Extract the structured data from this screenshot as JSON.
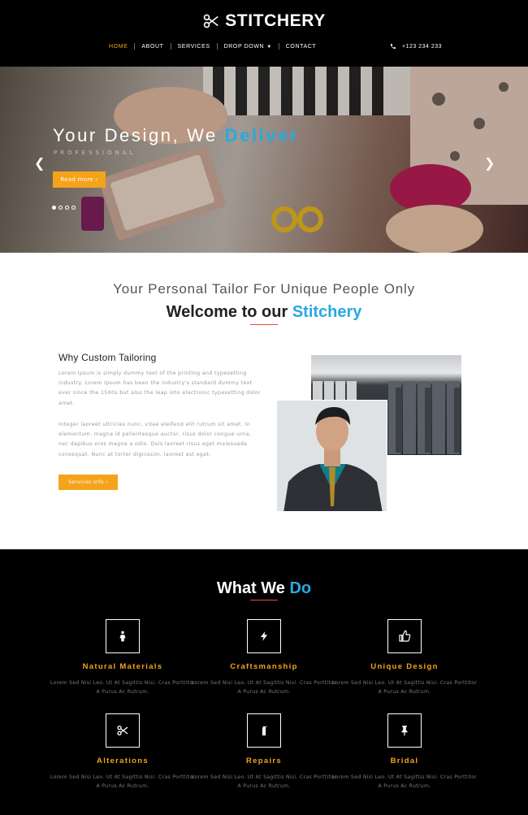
{
  "brand": {
    "name": "STITCHERY"
  },
  "nav": {
    "items": [
      "HOME",
      "ABOUT",
      "SERVICES",
      "DROP DOWN",
      "CONTACT"
    ],
    "active": "HOME",
    "phone": "+123 234 233"
  },
  "hero": {
    "title_part1": "Your Design, We",
    "title_accent": "Deliver",
    "subtitle": "Professional",
    "button": "Read more ›",
    "slides": 4,
    "active_slide": 1
  },
  "about": {
    "tagline": "Your Personal Tailor For Unique People Only",
    "title_part1": "Welcome to our",
    "title_accent": "Stitchery",
    "subheading": "Why Custom Tailoring",
    "paragraph1": "Lorem Ipsum is simply dummy text of the printing and typesetting industry. Lorem Ipsum has been the industry's standard dummy text ever since the 1500s but also the leap into electronic typesetting dolor amet.",
    "paragraph2": "Integer laoreet ultricies nunc, vitae eleifend elit rutrum sit amet. In elementum, magna id pellentesque auctor, risus dolor congue urna, nec dapibus eros magna a odio. Duis laoreet risus eget malesuada consequat. Nunc at tortor dignissim, laoreet est eget.",
    "button": "Services Info ›"
  },
  "services": {
    "title_part1": "What We",
    "title_accent": "Do",
    "items": [
      {
        "name": "Natural Materials",
        "desc": "Lorem Sed Nisi Leo. Ut At Sagittis Nisi. Cras Porttitor A Purus Ac Rutrum.",
        "icon": "person-icon"
      },
      {
        "name": "Craftsmanship",
        "desc": "Lorem Sed Nisi Leo. Ut At Sagittis Nisi. Cras Porttitor A Purus Ac Rutrum.",
        "icon": "bolt-icon"
      },
      {
        "name": "Unique Design",
        "desc": "Lorem Sed Nisi Leo. Ut At Sagittis Nisi. Cras Porttitor A Purus Ac Rutrum.",
        "icon": "thumbs-up-icon"
      },
      {
        "name": "Alterations",
        "desc": "Lorem Sed Nisi Leo. Ut At Sagittis Nisi. Cras Porttitor A Purus Ac Rutrum.",
        "icon": "scissors-icon"
      },
      {
        "name": "Repairs",
        "desc": "Lorem Sed Nisi Leo. Ut At Sagittis Nisi. Cras Porttitor A Purus Ac Rutrum.",
        "icon": "fire-extinguisher-icon"
      },
      {
        "name": "Bridal",
        "desc": "Lorem Sed Nisi Leo. Ut At Sagittis Nisi. Cras Porttitor A Purus Ac Rutrum.",
        "icon": "pushpin-icon"
      }
    ]
  },
  "colors": {
    "accent_orange": "#f5a31a",
    "accent_blue": "#29a9e1",
    "divider_red": "#e74c3c"
  }
}
